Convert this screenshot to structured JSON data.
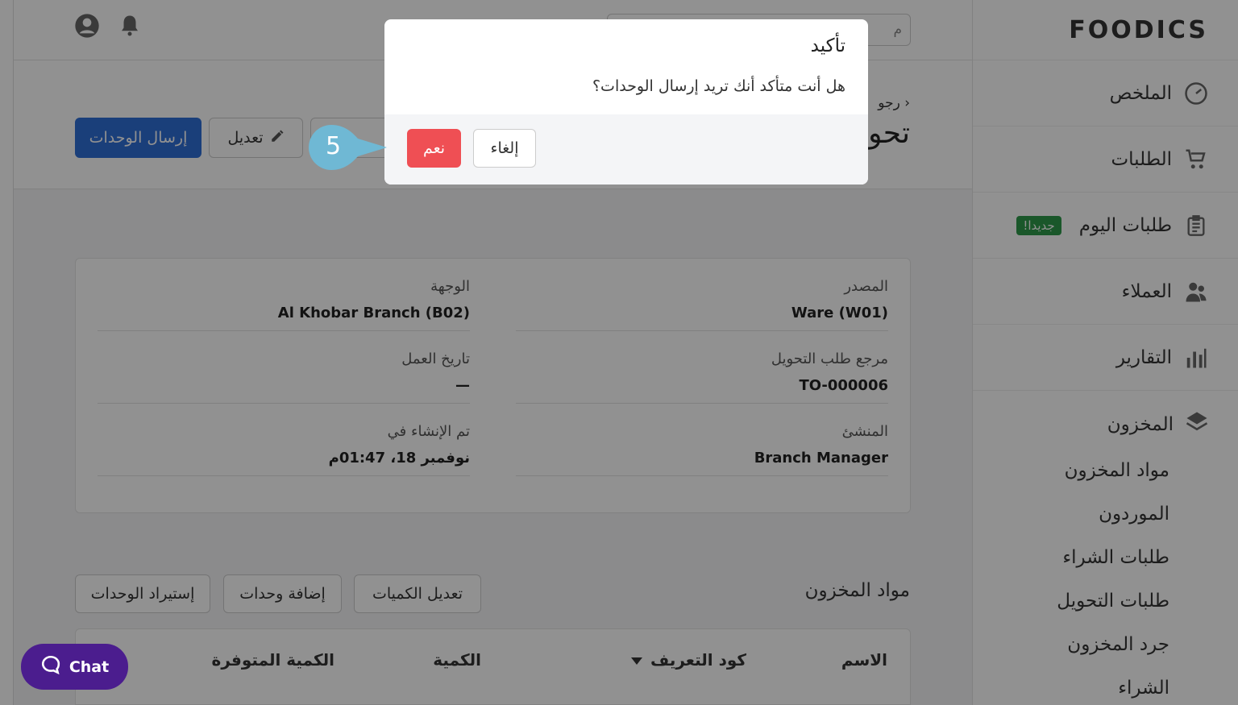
{
  "brand": {
    "name": "FOODICS"
  },
  "sidebar": {
    "items": [
      {
        "label": "الملخص",
        "icon": "gauge-icon"
      },
      {
        "label": "الطلبات",
        "icon": "cart-icon"
      },
      {
        "label": "طلبات اليوم",
        "icon": "clipboard-icon",
        "badge": "جديدا!"
      },
      {
        "label": "العملاء",
        "icon": "users-icon"
      },
      {
        "label": "التقارير",
        "icon": "bar-chart-icon"
      }
    ],
    "inventory": {
      "label": "المخزون",
      "icon": "layers-icon",
      "subitems": [
        "مواد المخزون",
        "الموردون",
        "طلبات الشراء",
        "طلبات التحويل",
        "جرد المخزون",
        "الشراء"
      ]
    }
  },
  "topbar": {
    "search_placeholder": "م"
  },
  "page": {
    "back": "رجو",
    "title": "تحو",
    "buttons": {
      "send": "إرسال الوحدات",
      "edit": "تعديل"
    }
  },
  "details": {
    "source_label": "المصدر",
    "source_value": "Ware (W01)",
    "dest_label": "الوجهة",
    "dest_value": "Al Khobar Branch (B02)",
    "ref_label": "مرجع طلب التحويل",
    "ref_value": "TO-000006",
    "date_label": "تاريخ العمل",
    "date_value": "—",
    "creator_label": "المنشئ",
    "creator_value": "Branch Manager",
    "created_label": "تم الإنشاء في",
    "created_value": "نوفمبر 18، 01:47م"
  },
  "items": {
    "title": "مواد المخزون",
    "buttons": {
      "edit_qty": "تعديل الكميات",
      "add_units": "إضافة وحدات",
      "import_units": "إستيراد الوحدات"
    },
    "columns": {
      "name": "الاسم",
      "sku": "كود التعريف",
      "qty": "الكمية",
      "available": "الكمية المتوفرة"
    }
  },
  "dialog": {
    "title": "تأكيد",
    "message": "هل أنت متأكد أنك تريد إرسال الوحدات؟",
    "cancel": "إلغاء",
    "confirm": "نعم"
  },
  "step_marker": "5",
  "chat": {
    "label": "Chat"
  },
  "colors": {
    "primary": "#2f6fd7",
    "danger": "#ef4f54",
    "marker": "#6fb8d4",
    "chat": "#4b1d8e",
    "badge": "#2e9a4b"
  }
}
